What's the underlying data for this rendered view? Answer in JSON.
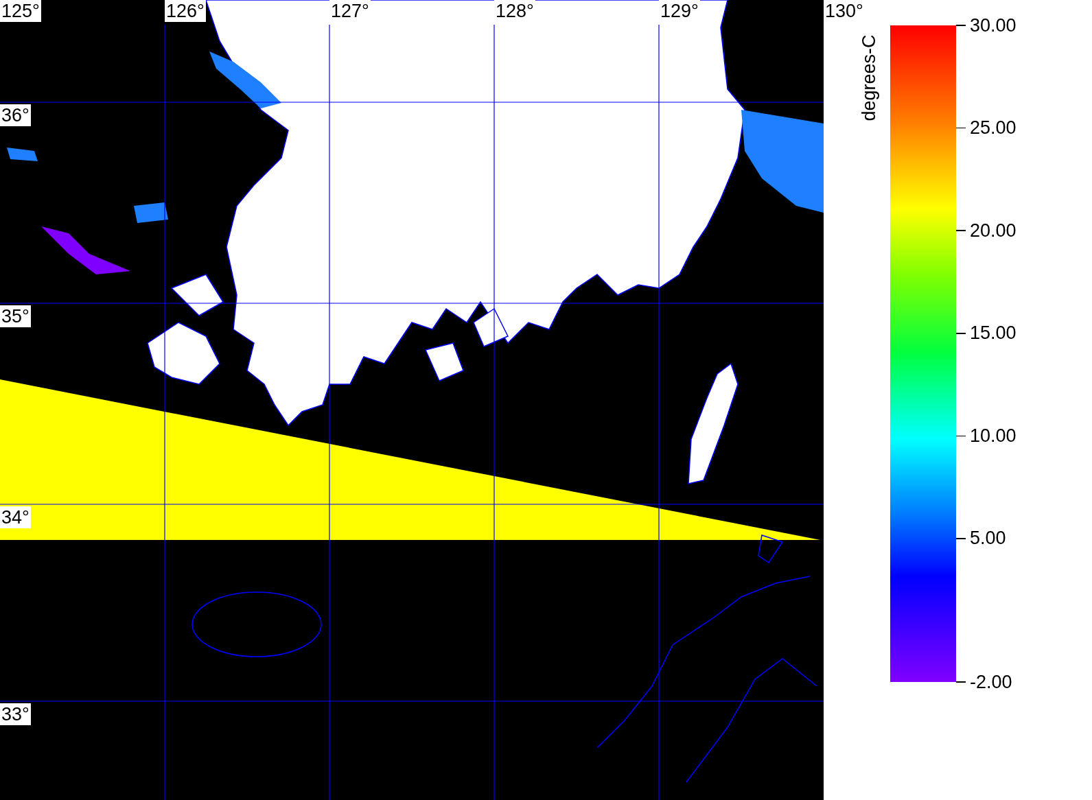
{
  "map": {
    "longitude_labels": [
      "125°",
      "126°",
      "127°",
      "128°",
      "129°",
      "130°"
    ],
    "latitude_labels": [
      "36°",
      "35°",
      "34°",
      "33°"
    ]
  },
  "colorbar": {
    "title": "degrees-C",
    "ticks": [
      "30.00",
      "25.00",
      "20.00",
      "15.00",
      "10.00",
      "5.00",
      "-2.00"
    ]
  }
}
